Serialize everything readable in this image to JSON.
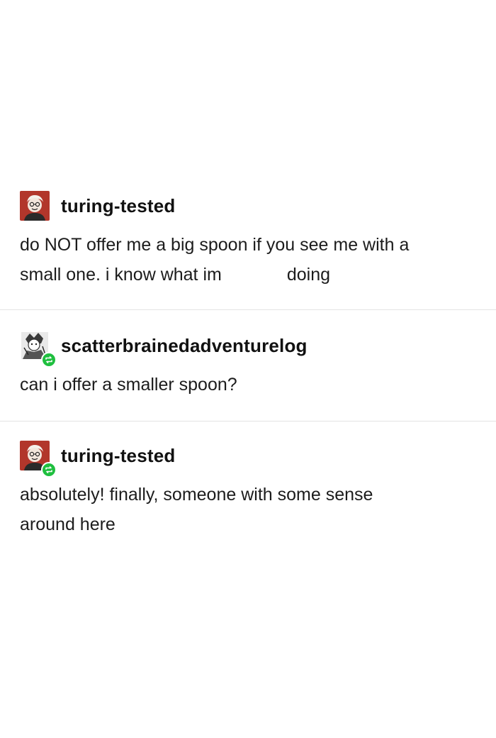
{
  "posts": [
    {
      "username": "turing-tested",
      "avatar_icon": "cartoon-avatar-red-icon",
      "reblogged": false,
      "body_line1": "do NOT offer me a big spoon if you see me with a",
      "body_line2a": "small one. i know what im",
      "body_line2b": "doing"
    },
    {
      "username": "scatterbrainedadventurelog",
      "avatar_icon": "sketch-avatar-bw-icon",
      "reblogged": true,
      "body": "can i offer a smaller spoon?"
    },
    {
      "username": "turing-tested",
      "avatar_icon": "cartoon-avatar-red-icon",
      "reblogged": true,
      "body_line1": "absolutely! finally, someone with some sense",
      "body_line2": "around here"
    }
  ],
  "colors": {
    "reblog_badge": "#1fbf3f",
    "avatar_red": "#b2362b",
    "divider": "#e3e3e3"
  }
}
